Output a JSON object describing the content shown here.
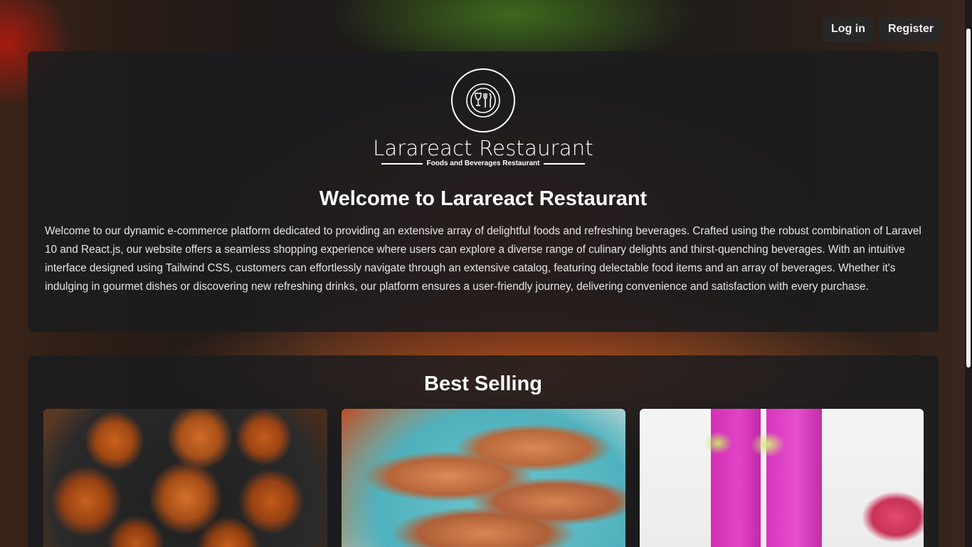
{
  "nav": {
    "login_label": "Log in",
    "register_label": "Register"
  },
  "hero": {
    "logo_title": "Larareact Restaurant",
    "logo_subtitle": "Foods and Beverages Restaurant",
    "title": "Welcome to Larareact Restaurant",
    "description": "Welcome to our dynamic e-commerce platform dedicated to providing an extensive array of delightful foods and refreshing beverages. Crafted using the robust combination of Laravel 10 and React.js, our website offers a seamless shopping experience where users can explore a diverse range of culinary delights and thirst-quenching beverages. With an intuitive interface designed using Tailwind CSS, customers can effortlessly navigate through an extensive catalog, featuring delectable food items and an array of beverages. Whether it's indulging in gourmet dishes or discovering new refreshing drinks, our platform ensures a user-friendly journey, delivering convenience and satisfaction with every purchase."
  },
  "best_selling": {
    "title": "Best Selling",
    "items": [
      {
        "image": "fried-chicken"
      },
      {
        "image": "grilled-salmon"
      },
      {
        "image": "dragon-fruit-drinks"
      }
    ]
  },
  "colors": {
    "panel_bg": "#1c1c1e",
    "button_bg": "#282828",
    "text": "#ffffff"
  },
  "icons": {
    "logo": "dining-icon"
  }
}
